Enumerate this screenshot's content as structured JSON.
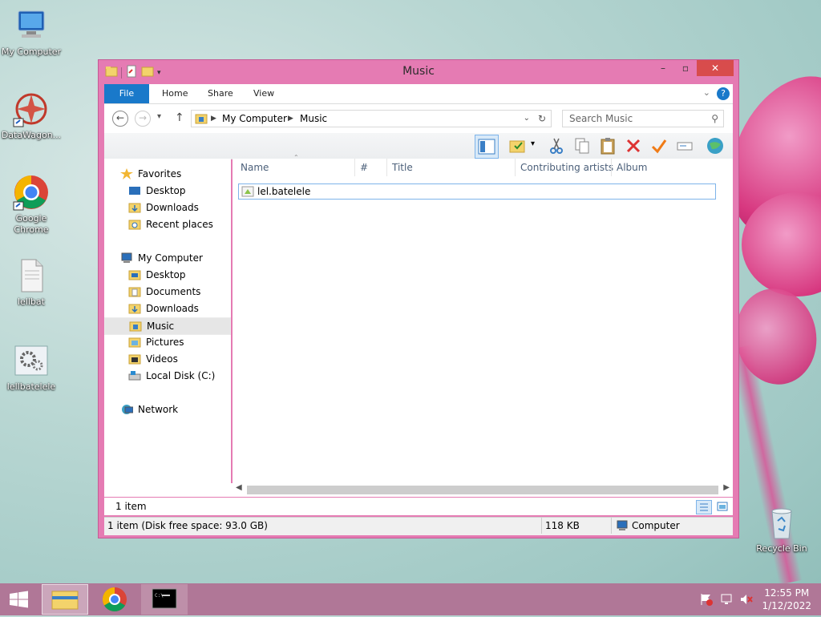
{
  "desktop": {
    "icons": [
      {
        "label": "My Computer"
      },
      {
        "label": "DataWagon..."
      },
      {
        "label": "Google Chrome"
      },
      {
        "label": "lellbat"
      },
      {
        "label": "lellbatelele"
      },
      {
        "label": "Recycle Bin"
      }
    ]
  },
  "window": {
    "title": "Music",
    "ribbon_tabs": [
      "File",
      "Home",
      "Share",
      "View"
    ],
    "address": {
      "segments": [
        "My Computer",
        "Music"
      ]
    },
    "search": {
      "placeholder": "Search Music"
    }
  },
  "navpane": {
    "favorites": {
      "label": "Favorites",
      "items": [
        "Desktop",
        "Downloads",
        "Recent places"
      ]
    },
    "computer": {
      "label": "My Computer",
      "items": [
        "Desktop",
        "Documents",
        "Downloads",
        "Music",
        "Pictures",
        "Videos",
        "Local Disk (C:)"
      ]
    },
    "network": {
      "label": "Network"
    }
  },
  "columns": [
    "Name",
    "#",
    "Title",
    "Contributing artists",
    "Album"
  ],
  "files": [
    {
      "name": "lel.batelele"
    }
  ],
  "status": {
    "items": "1 item"
  },
  "details": {
    "left": "1 item (Disk free space: 93.0 GB)",
    "size": "118 KB",
    "location": "Computer"
  },
  "taskbar": {
    "time": "12:55 PM",
    "date": "1/12/2022"
  },
  "colors": {
    "window_border": "#e57bb3",
    "file_tab": "#1979ca",
    "taskbar": "#b07797",
    "close": "#d84c4c"
  }
}
